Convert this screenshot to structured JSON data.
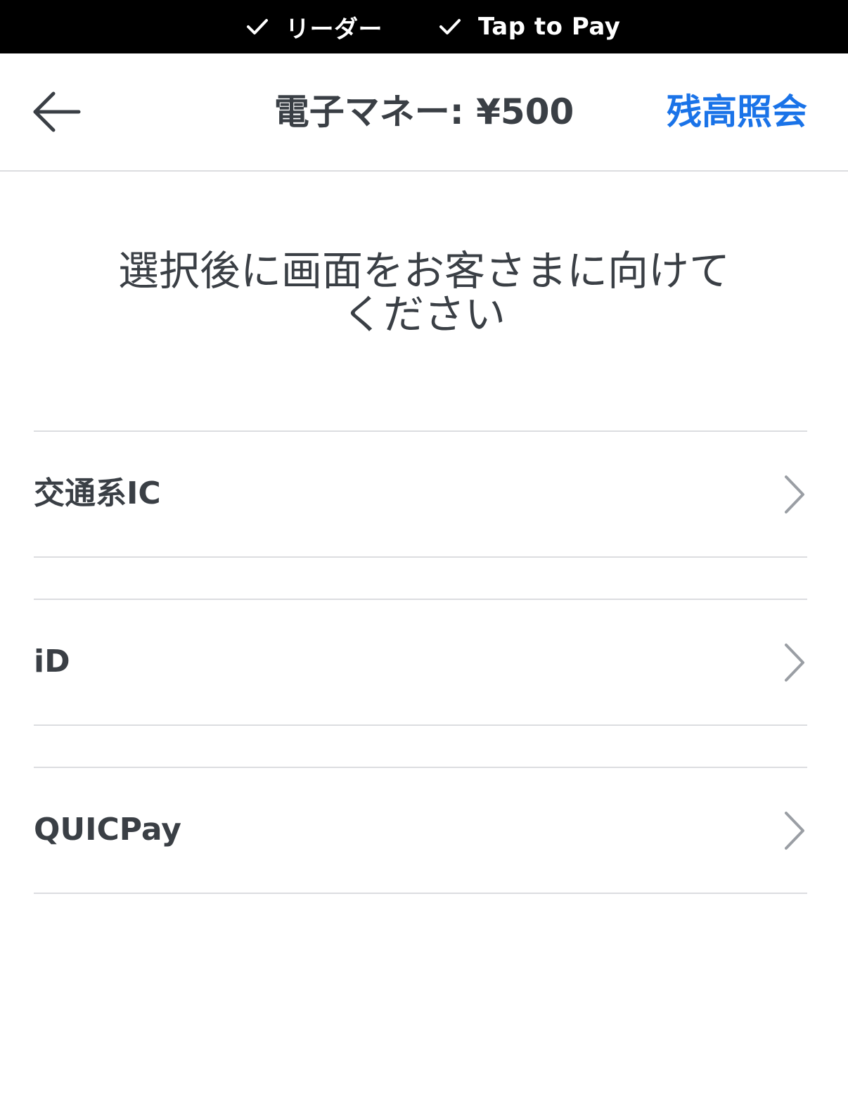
{
  "status_bar": {
    "items": [
      {
        "label": "リーダー",
        "icon": "checkmark-icon"
      },
      {
        "label": "Tap to Pay",
        "icon": "checkmark-icon"
      }
    ]
  },
  "header": {
    "back_icon": "arrow-left-icon",
    "title": "電子マネー: ¥500",
    "balance_inquiry_label": "残高照会",
    "accent_color": "#1a73e8"
  },
  "instruction": {
    "line1": "選択後に画面をお客さまに向けて",
    "line2": "ください"
  },
  "payment_methods": [
    {
      "label": "交通系IC",
      "icon": "chevron-right-icon"
    },
    {
      "label": "iD",
      "icon": "chevron-right-icon"
    },
    {
      "label": "QUICPay",
      "icon": "chevron-right-icon"
    }
  ]
}
